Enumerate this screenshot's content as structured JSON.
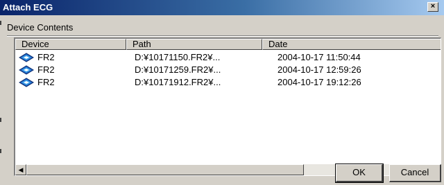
{
  "window": {
    "title": "Attach ECG"
  },
  "group": {
    "label": "Device Contents"
  },
  "list": {
    "columns": [
      "Device",
      "Path",
      "Date"
    ],
    "rows": [
      {
        "device": "FR2",
        "path": "D:¥10171150.FR2¥...",
        "date": "2004-10-17 11:50:44"
      },
      {
        "device": "FR2",
        "path": "D:¥10171259.FR2¥...",
        "date": "2004-10-17 12:59:26"
      },
      {
        "device": "FR2",
        "path": "D:¥10171912.FR2¥...",
        "date": "2004-10-17 19:12:26"
      }
    ],
    "row_icon": "device-card-icon"
  },
  "buttons": {
    "ok": "OK",
    "cancel": "Cancel"
  },
  "colors": {
    "title_start": "#0a246a",
    "title_end": "#a6caf0",
    "face": "#d4d0c8"
  }
}
